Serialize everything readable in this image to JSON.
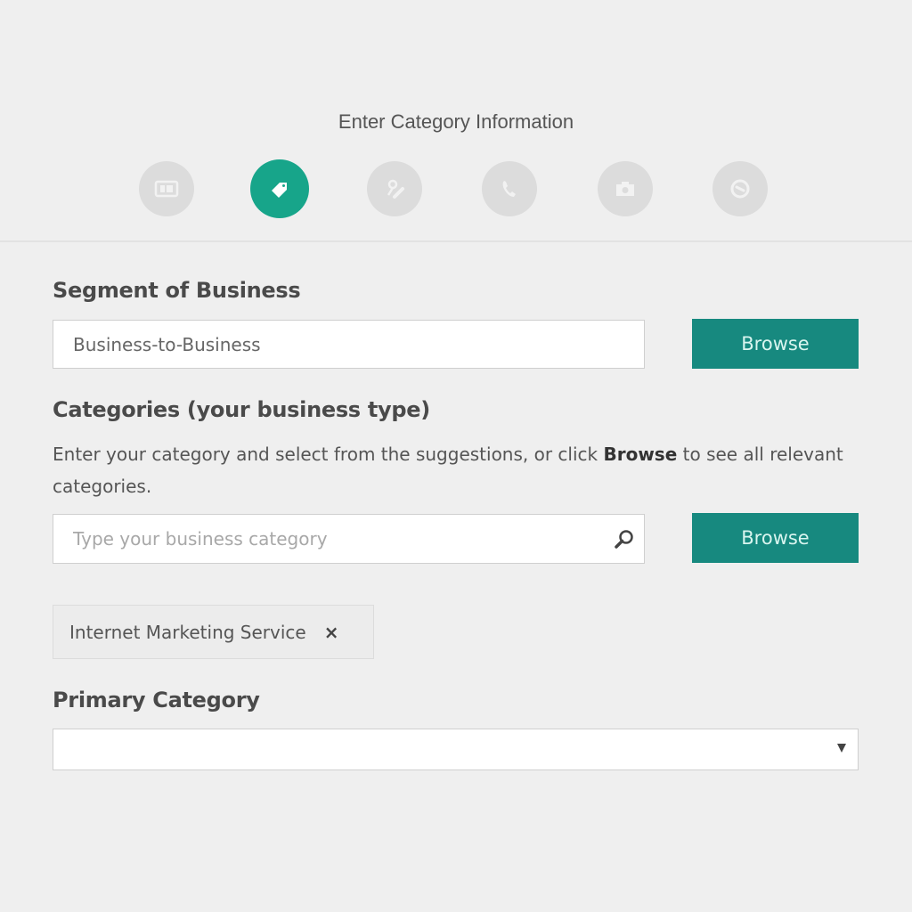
{
  "wizard": {
    "title": "Enter Category Information",
    "steps": [
      {
        "icon": "business-card-icon",
        "active": false
      },
      {
        "icon": "tag-icon",
        "active": true
      },
      {
        "icon": "person-edit-icon",
        "active": false
      },
      {
        "icon": "phone-icon",
        "active": false
      },
      {
        "icon": "camera-icon",
        "active": false
      },
      {
        "icon": "clock-icon",
        "active": false
      }
    ],
    "accent_color": "#17a58a"
  },
  "segment": {
    "label": "Segment of Business",
    "value": "Business-to-Business",
    "browse_label": "Browse"
  },
  "categories": {
    "label": "Categories (your business type)",
    "help_prefix": "Enter your category and select from the suggestions, or click ",
    "help_bold": "Browse",
    "help_suffix": " to see all relevant categories.",
    "placeholder": "Type your business category",
    "value": "",
    "browse_label": "Browse",
    "selected_tags": [
      {
        "label": "Internet Marketing Service",
        "remove_glyph": "×"
      }
    ]
  },
  "primary_category": {
    "label": "Primary Category",
    "selected": ""
  },
  "colors": {
    "button": "#17897f",
    "button_text": "#d9f5ef",
    "background": "#efefef"
  }
}
